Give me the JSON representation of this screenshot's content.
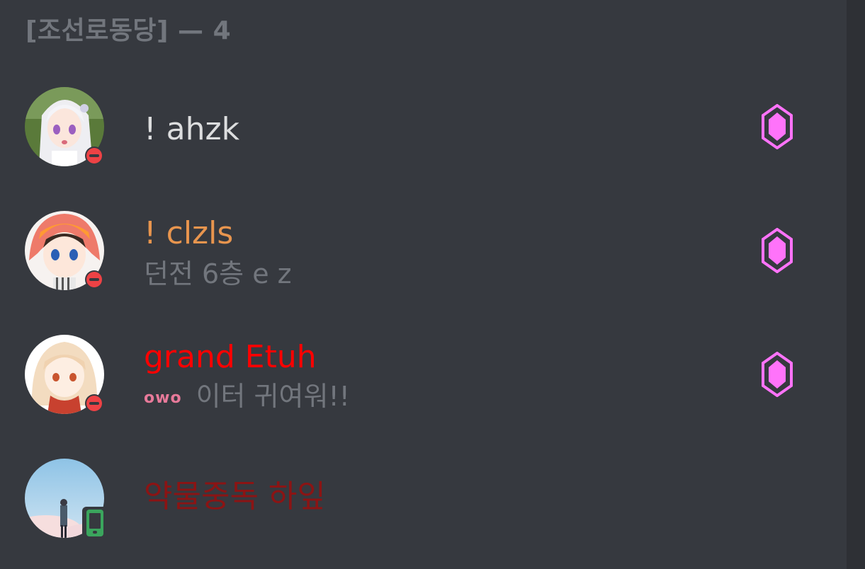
{
  "group": {
    "header": "[조선로동당] — 4"
  },
  "members": [
    {
      "name": "! ahzk",
      "name_color": "#dcddde",
      "activity": "",
      "status": "dnd",
      "boost_icon": "nitro-boost-icon"
    },
    {
      "name": "! clzls",
      "name_color": "#e8954e",
      "activity": "던전 6층 e z",
      "status": "dnd",
      "boost_icon": "nitro-boost-icon"
    },
    {
      "name": "grand Etuh",
      "name_color": "#ff0000",
      "activity_emoji": "owo",
      "activity": "이터 귀여워!!",
      "status": "dnd",
      "boost_icon": "nitro-boost-icon"
    },
    {
      "name": "약물중독 하잎",
      "name_color": "#8b1414",
      "activity": "",
      "status": "mobile-online"
    }
  ],
  "colors": {
    "background": "#36393f",
    "boost": "#ff73fa",
    "dnd": "#ed4245",
    "online": "#3ba55d",
    "muted_text": "#72767d"
  }
}
